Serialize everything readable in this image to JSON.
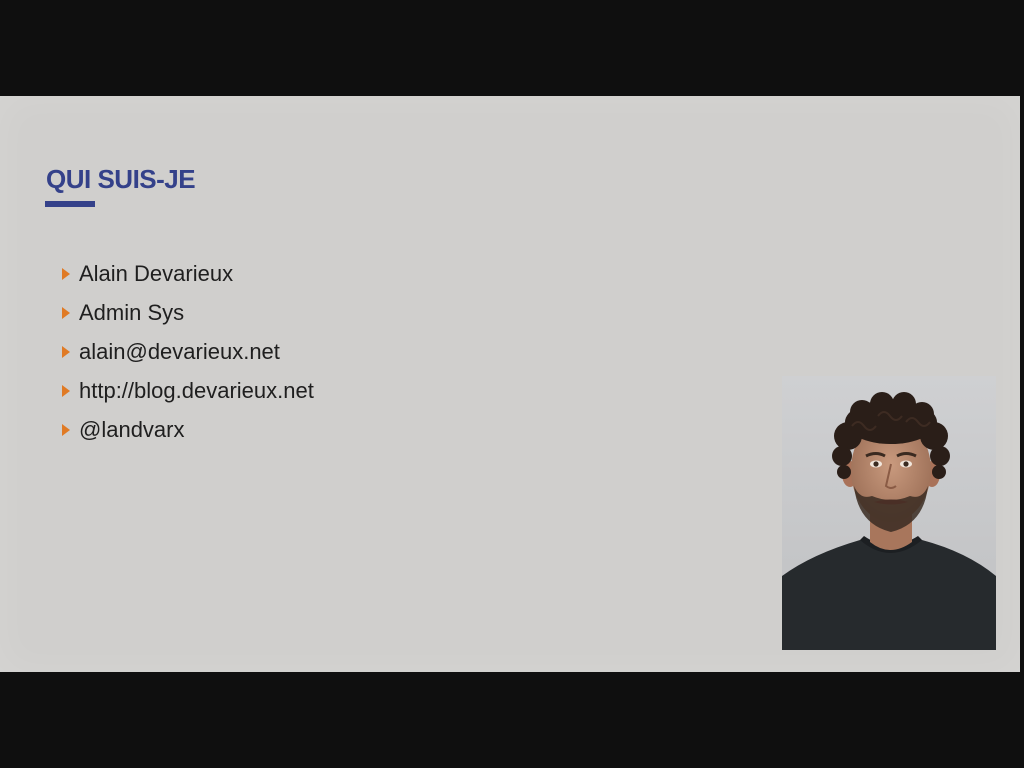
{
  "slide": {
    "title": "QUI SUIS-JE",
    "bullets": [
      "Alain Devarieux",
      "Admin Sys",
      "alain@devarieux.net",
      "http://blog.devarieux.net",
      "@landvarx"
    ]
  },
  "colors": {
    "title": "#34418a",
    "bullet_marker": "#e07a24",
    "slide_background": "#d0cfcd",
    "letterbox": "#0f0f0f"
  },
  "icons": {
    "bullet": "triangle-right-icon"
  }
}
